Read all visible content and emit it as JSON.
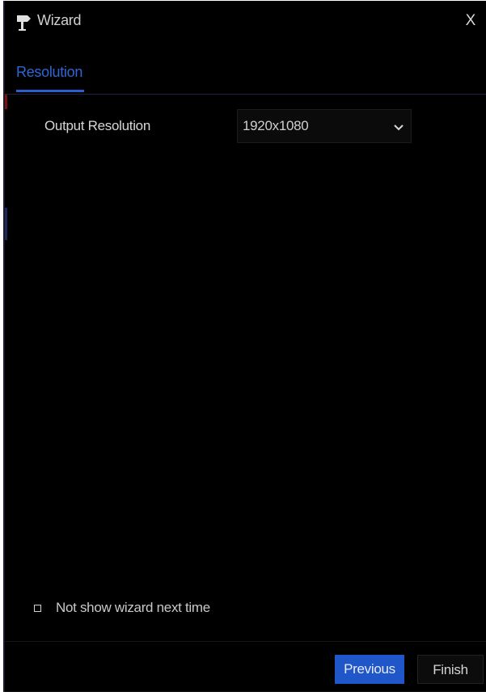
{
  "window": {
    "title": "Wizard",
    "close_label": "X",
    "title_icon": "wizard-signpost-icon"
  },
  "tabs": [
    {
      "label": "Resolution",
      "active": true
    }
  ],
  "form": {
    "output_resolution_label": "Output Resolution",
    "output_resolution_value": "1920x1080",
    "dropdown_icon": "chevron-down-icon"
  },
  "footer": {
    "not_show_label": "Not show wizard next time",
    "not_show_checked": false,
    "previous_label": "Previous",
    "finish_label": "Finish"
  },
  "colors": {
    "background": "#000000",
    "accent": "#1f56c8",
    "tab_active": "#2f66d6",
    "text": "#d6d6d6"
  }
}
